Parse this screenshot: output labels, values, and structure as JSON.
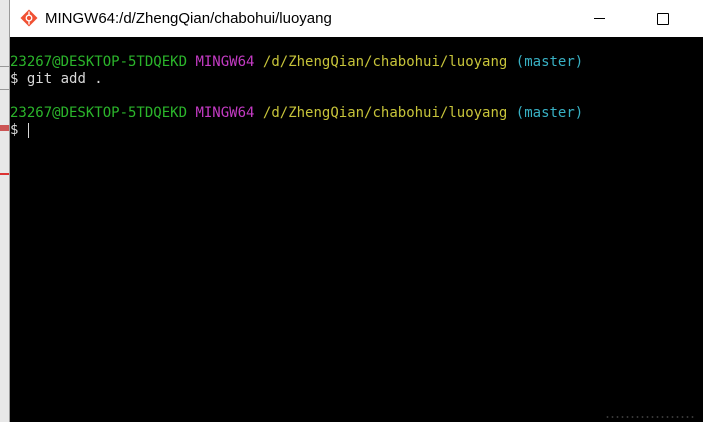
{
  "window": {
    "title": "MINGW64:/d/ZhengQian/chabohui/luoyang",
    "icon": "git-bash-icon"
  },
  "controls": {
    "minimize": "minimize-icon",
    "maximize": "maximize-icon"
  },
  "terminal": {
    "lines": [
      {
        "user_host": "23267@DESKTOP-5TDQEKD",
        "env": "MINGW64",
        "path": "/d/ZhengQian/chabohui/luoyang",
        "branch": "(master)"
      },
      {
        "prompt": "$",
        "command": "git add ."
      },
      {
        "user_host": "23267@DESKTOP-5TDQEKD",
        "env": "MINGW64",
        "path": "/d/ZhengQian/chabohui/luoyang",
        "branch": "(master)"
      },
      {
        "prompt": "$",
        "command": ""
      }
    ]
  },
  "colors": {
    "user_host": "#2bb52b",
    "env": "#c43bc4",
    "path": "#c7c43a",
    "branch": "#38b1c4",
    "background": "#000000"
  }
}
